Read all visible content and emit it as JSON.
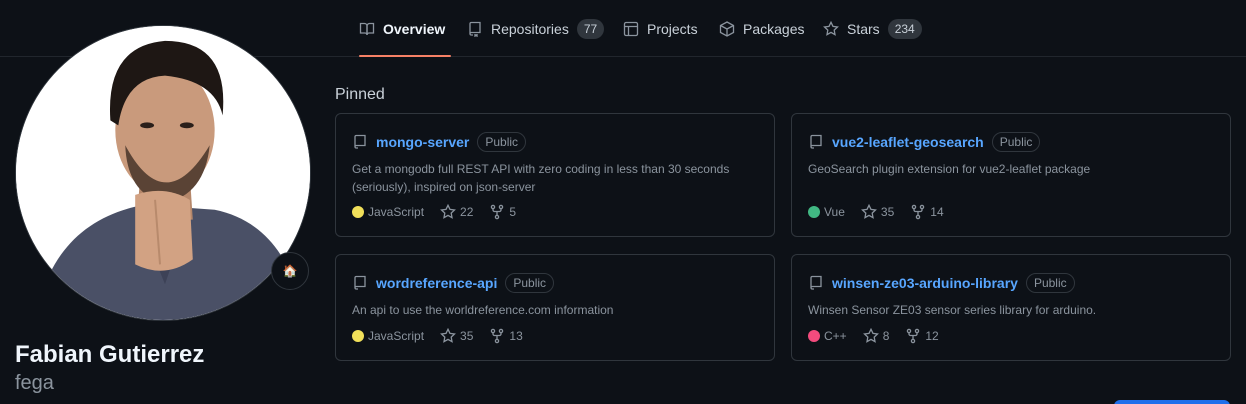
{
  "nav": {
    "tabs": [
      {
        "label": "Overview",
        "icon": "book-icon",
        "active": true
      },
      {
        "label": "Repositories",
        "icon": "repo-icon",
        "count": "77"
      },
      {
        "label": "Projects",
        "icon": "table-icon"
      },
      {
        "label": "Packages",
        "icon": "package-icon"
      },
      {
        "label": "Stars",
        "icon": "star-icon",
        "count": "234"
      }
    ],
    "active_underline_color": "#f78166"
  },
  "profile": {
    "full_name": "Fabian Gutierrez",
    "username": "fega",
    "status_emoji": "🏠"
  },
  "pinned": {
    "title": "Pinned",
    "repos": [
      {
        "name": "mongo-server",
        "visibility": "Public",
        "description": "Get a mongodb full REST API with zero coding in less than 30 seconds (seriously), inspired on json-server",
        "language": "JavaScript",
        "language_color": "#f1e05a",
        "stars": "22",
        "forks": "5"
      },
      {
        "name": "vue2-leaflet-geosearch",
        "visibility": "Public",
        "description": "GeoSearch plugin extension for vue2-leaflet package",
        "language": "Vue",
        "language_color": "#41b883",
        "stars": "35",
        "forks": "14"
      },
      {
        "name": "wordreference-api",
        "visibility": "Public",
        "description": "An api to use the worldreference.com information",
        "language": "JavaScript",
        "language_color": "#f1e05a",
        "stars": "35",
        "forks": "13"
      },
      {
        "name": "winsen-ze03-arduino-library",
        "visibility": "Public",
        "description": "Winsen Sensor ZE03 sensor series library for arduino.",
        "language": "C++",
        "language_color": "#f34b7d",
        "stars": "8",
        "forks": "12"
      }
    ]
  },
  "colors": {
    "background": "#0d1117",
    "link": "#58a6ff",
    "border": "#30363d",
    "muted": "#8b949e"
  }
}
